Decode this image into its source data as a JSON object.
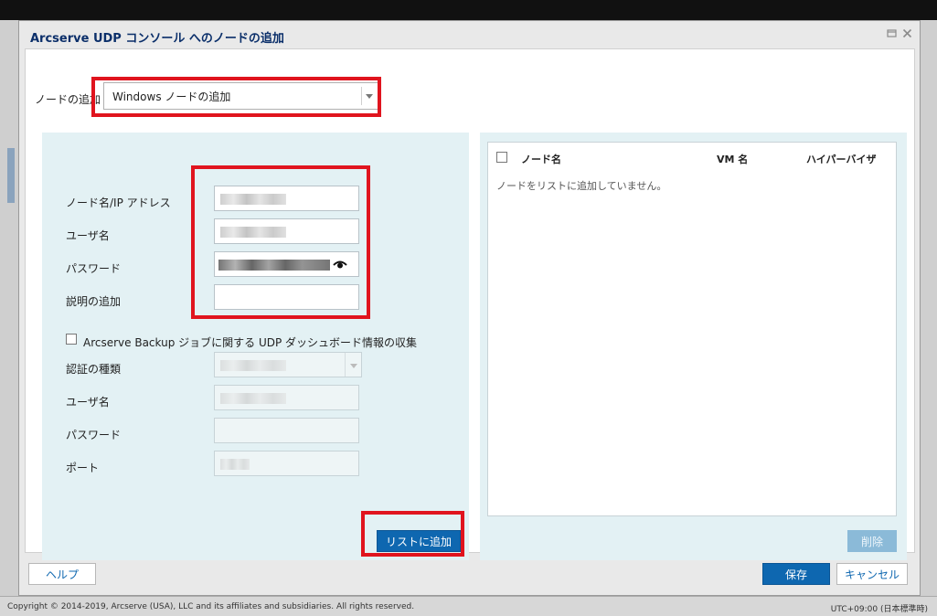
{
  "dialog": {
    "title": "Arcserve UDP コンソール へのノードの追加",
    "add_node_label": "ノードの追加",
    "add_node_selected": "Windows ノードの追加"
  },
  "node_form": {
    "hostname_label": "ノード名/IP アドレス",
    "username_label": "ユーザ名",
    "password_label": "パスワード",
    "description_label": "説明の追加",
    "arcserve_backup_checkbox": "Arcserve Backup ジョブに関する UDP ダッシュボード情報の収集",
    "auth_type_label": "認証の種類",
    "backup_username_label": "ユーザ名",
    "backup_password_label": "パスワード",
    "port_label": "ポート",
    "add_to_list_button": "リストに追加"
  },
  "node_list": {
    "columns": [
      "ノード名",
      "VM 名",
      "ハイパーバイザ"
    ],
    "empty_message": "ノードをリストに追加していません。",
    "delete_button": "削除"
  },
  "buttons": {
    "help": "ヘルプ",
    "save": "保存",
    "cancel": "キャンセル"
  },
  "statusbar": {
    "copyright": "Copyright © 2014-2019, Arcserve (USA), LLC and its affiliates and subsidiaries. All rights reserved.",
    "timezone": "UTC+09:00 (日本標準時)"
  },
  "icons": {
    "restore": "restore-icon",
    "close": "close-icon",
    "password_reveal": "eye-icon",
    "dropdown": "chevron-down-icon"
  },
  "colors": {
    "primary_button": "#0e67b0",
    "panel_bg": "#e3f1f4",
    "highlight": "#e0141e",
    "title": "#0b2f6a"
  }
}
